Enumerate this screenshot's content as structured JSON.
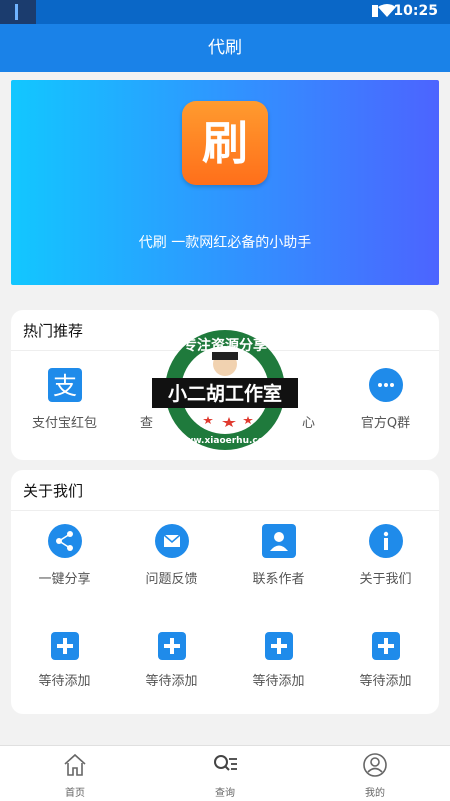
{
  "status_bar": {
    "time": "10:25"
  },
  "app_bar": {
    "title": "代刷"
  },
  "banner": {
    "logo_char": "刷",
    "tagline": "代刷  一款网红必备的小助手"
  },
  "hot": {
    "title": "热门推荐",
    "items": [
      {
        "label": "支付宝红包",
        "icon": "alipay-icon"
      },
      {
        "label": "查",
        "icon": "search-icon"
      },
      {
        "label": "心",
        "icon": "heart-icon"
      },
      {
        "label": "官方Q群",
        "icon": "chat-icon"
      }
    ]
  },
  "about": {
    "title": "关于我们",
    "row1": [
      {
        "label": "一键分享",
        "icon": "share-icon"
      },
      {
        "label": "问题反馈",
        "icon": "mail-icon"
      },
      {
        "label": "联系作者",
        "icon": "person-icon"
      },
      {
        "label": "关于我们",
        "icon": "info-icon"
      }
    ],
    "row2": [
      {
        "label": "等待添加",
        "icon": "plus-icon"
      },
      {
        "label": "等待添加",
        "icon": "plus-icon"
      },
      {
        "label": "等待添加",
        "icon": "plus-icon"
      },
      {
        "label": "等待添加",
        "icon": "plus-icon"
      }
    ]
  },
  "watermark": {
    "top_text": "专注资源分享",
    "center_text": "小二胡工作室",
    "bottom_text": "www.xiaoerhu.com"
  },
  "nav": [
    {
      "label": "首页",
      "icon": "home-icon"
    },
    {
      "label": "查询",
      "icon": "query-icon"
    },
    {
      "label": "我的",
      "icon": "user-icon"
    }
  ],
  "colors": {
    "primary": "#1a82e8",
    "icon_blue": "#1f8bea",
    "logo_orange": "#ff7f22"
  }
}
